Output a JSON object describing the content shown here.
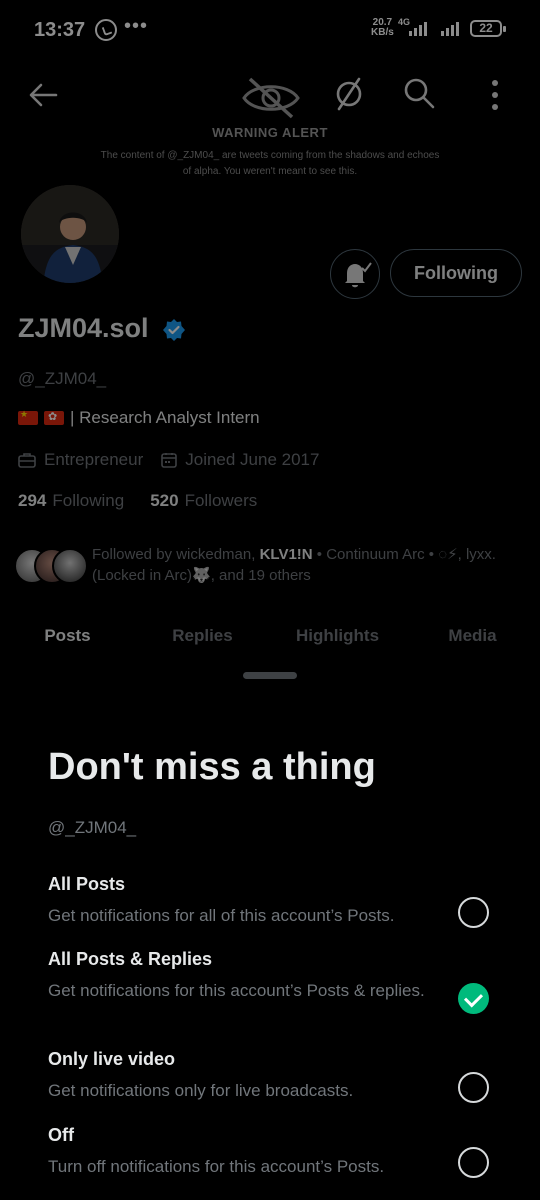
{
  "status_bar": {
    "time": "13:37",
    "more": "•••",
    "speed_value": "20.7",
    "speed_unit": "KB/s",
    "network": "4G",
    "battery": "22"
  },
  "header": {
    "warning_title": "WARNING ALERT",
    "warning_text": "The content of @_ZJM04_ are tweets coming from the shadows and echoes of alpha. You weren't meant to see this."
  },
  "profile": {
    "follow_button": "Following",
    "display_name": "ZJM04.sol",
    "handle": "@_ZJM04_",
    "bio": "| Research Analyst Intern",
    "profession": "Entrepreneur",
    "joined": "Joined June 2017",
    "following_count": "294",
    "following_label": "Following",
    "followers_count": "520",
    "followers_label": "Followers",
    "followed_by_prefix": "Followed by wickedman, ",
    "followed_by_bold": "KLV1!N",
    "followed_by_rest": " • Continuum Arc • ◌⚡, lyxx.(Locked in Arc)🐺, and 19 others"
  },
  "tabs": [
    "Posts",
    "Replies",
    "Highlights",
    "Media"
  ],
  "sheet": {
    "title": "Don't miss a thing",
    "handle": "@_ZJM04_",
    "options": [
      {
        "title": "All Posts",
        "description": "Get notifications for all of this account’s Posts.",
        "selected": false
      },
      {
        "title": "All Posts & Replies",
        "description": "Get notifications for this account’s Posts & replies.",
        "selected": true
      },
      {
        "title": "Only live video",
        "description": "Get notifications only for live broadcasts.",
        "selected": false
      },
      {
        "title": "Off",
        "description": "Turn off notifications for this account’s Posts.",
        "selected": false
      }
    ]
  },
  "colors": {
    "accent_green": "#00ba7c",
    "verified_blue": "#1d9bf0",
    "muted_text": "#71767b"
  },
  "icons": [
    "back-arrow-icon",
    "crossed-eye-icon",
    "solana-icon",
    "search-icon",
    "more-vert-icon",
    "bell-icon",
    "verified-icon",
    "briefcase-icon",
    "calendar-icon"
  ]
}
